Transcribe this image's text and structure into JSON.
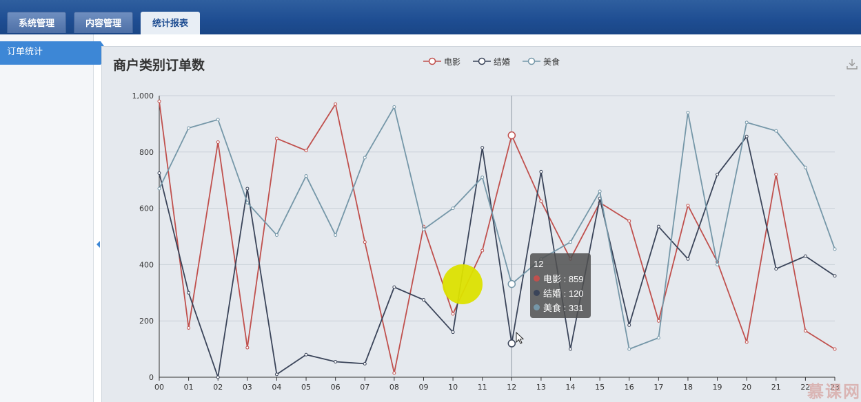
{
  "tabs": [
    {
      "label": "系统管理",
      "active": false
    },
    {
      "label": "内容管理",
      "active": false
    },
    {
      "label": "统计报表",
      "active": true
    }
  ],
  "sidebar": {
    "items": [
      {
        "label": "订单统计",
        "active": true
      }
    ]
  },
  "watermark": "慕课网",
  "chart_data": {
    "type": "line",
    "title": "商户类别订单数",
    "x": [
      "00",
      "01",
      "02",
      "03",
      "04",
      "05",
      "06",
      "07",
      "08",
      "09",
      "10",
      "11",
      "12",
      "13",
      "14",
      "15",
      "16",
      "17",
      "18",
      "19",
      "20",
      "21",
      "22",
      "23"
    ],
    "ylim": [
      0,
      1000
    ],
    "yticks": [
      "0",
      "200",
      "400",
      "600",
      "800",
      "1,000"
    ],
    "grid": true,
    "legend_position": "top-center",
    "series": [
      {
        "name": "电影",
        "color": "#c0504d",
        "values": [
          980,
          175,
          835,
          105,
          848,
          805,
          970,
          480,
          15,
          535,
          225,
          450,
          859,
          625,
          420,
          620,
          555,
          200,
          610,
          410,
          125,
          720,
          165,
          100
        ]
      },
      {
        "name": "结婚",
        "color": "#3a4459",
        "values": [
          725,
          300,
          0,
          670,
          10,
          80,
          55,
          48,
          320,
          275,
          160,
          815,
          120,
          730,
          100,
          635,
          185,
          535,
          420,
          720,
          855,
          385,
          430,
          360
        ]
      },
      {
        "name": "美食",
        "color": "#7597a8",
        "values": [
          670,
          885,
          915,
          620,
          505,
          715,
          505,
          780,
          960,
          525,
          600,
          710,
          331,
          420,
          480,
          660,
          100,
          140,
          940,
          400,
          905,
          875,
          745,
          455
        ]
      }
    ],
    "tooltip": {
      "category": "12",
      "rows": [
        {
          "label": "电影 : 859",
          "color": "#c0504d"
        },
        {
          "label": "结婚 : 120",
          "color": "#3a4459"
        },
        {
          "label": "美食 : 331",
          "color": "#7597a8"
        }
      ]
    }
  }
}
